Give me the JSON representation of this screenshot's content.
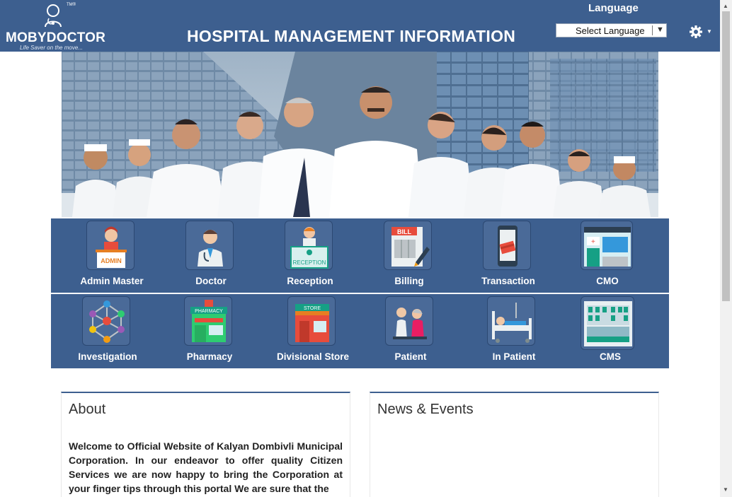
{
  "header": {
    "logo_name": "MOBYDOCTOR",
    "logo_tm": "TM®",
    "logo_tagline": "Life Saver on the move...",
    "title": "HOSPITAL MANAGEMENT INFORMATION",
    "language_label": "Language",
    "language_select_value": "Select Language",
    "brand_color": "#3d5f8f"
  },
  "modules_row1": [
    {
      "label": "Admin Master",
      "icon": "admin-icon"
    },
    {
      "label": "Doctor",
      "icon": "doctor-icon"
    },
    {
      "label": "Reception",
      "icon": "reception-icon"
    },
    {
      "label": "Billing",
      "icon": "billing-icon"
    },
    {
      "label": "Transaction",
      "icon": "transaction-icon"
    },
    {
      "label": "CMO",
      "icon": "cmo-icon"
    }
  ],
  "modules_row2": [
    {
      "label": "Investigation",
      "icon": "investigation-icon"
    },
    {
      "label": "Pharmacy",
      "icon": "pharmacy-icon"
    },
    {
      "label": "Divisional Store",
      "icon": "store-icon"
    },
    {
      "label": "Patient",
      "icon": "patient-icon"
    },
    {
      "label": "In Patient",
      "icon": "in-patient-icon"
    },
    {
      "label": "CMS",
      "icon": "cms-icon"
    }
  ],
  "icon_text": {
    "admin": "ADMIN",
    "reception": "RECEPTION",
    "billing": "BILL",
    "pharmacy": "PHARMACY",
    "store": "STORE"
  },
  "about": {
    "title": "About",
    "text": "Welcome to Official Website of Kalyan Dombivli Municipal Corporation. In our endeavor to offer quality Citizen Services we are now happy to bring the Corporation at your finger tips through this portal We are sure that the"
  },
  "news": {
    "title": "News & Events"
  }
}
